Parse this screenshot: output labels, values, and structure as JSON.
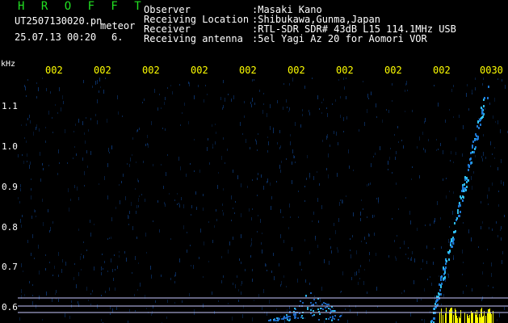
{
  "header": {
    "app_title": "H R O F F T",
    "file_name": "UT2507130020.pn",
    "meteor_label": "meteor",
    "datetime": "25.07.13 00:20",
    "count": "6.",
    "info": [
      {
        "label": "Observer",
        "value": ":Masaki Kano"
      },
      {
        "label": "Receiving Location",
        "value": ":Shibukawa,Gunma,Japan"
      },
      {
        "label": "Receiver",
        "value": ":RTL-SDR SDR# 43dB L15 114.1MHz USB"
      },
      {
        "label": "Receiving antenna",
        "value": ":5el Yagi Az 20 for Aomori VOR"
      }
    ]
  },
  "axis": {
    "y_unit": "kHz",
    "y_ticks": [
      "1.1",
      "1.0",
      "0.9",
      "0.8",
      "0.7",
      "0.6"
    ],
    "x_ticks": [
      "002",
      "002",
      "002",
      "002",
      "002",
      "002",
      "002",
      "002",
      "002",
      "0030"
    ]
  },
  "colors": {
    "background": "#000000",
    "header_green": "#22e022",
    "header_text": "#ffffff",
    "time_labels": "#ffff00",
    "noise_blue": "#0d3a7a",
    "echo_cyan": "#33ccff",
    "echo_yellow": "#ffff00",
    "marker_line": "#c8c8ff"
  }
}
